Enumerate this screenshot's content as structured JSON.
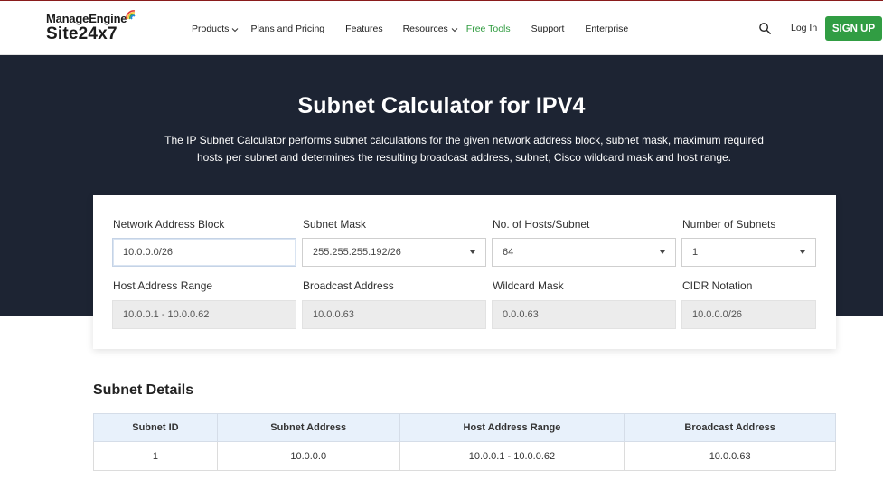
{
  "header": {
    "brand_top": "ManageEngine",
    "brand_main": "Site24x7",
    "nav": [
      {
        "label": "Products",
        "has_dropdown": true
      },
      {
        "label": "Plans and Pricing",
        "has_dropdown": false
      },
      {
        "label": "Features",
        "has_dropdown": false
      },
      {
        "label": "Resources",
        "has_dropdown": true
      },
      {
        "label": "Free Tools",
        "has_dropdown": false
      },
      {
        "label": "Support",
        "has_dropdown": false
      },
      {
        "label": "Enterprise",
        "has_dropdown": false
      }
    ],
    "login_label": "Log In",
    "signup_label": "SIGN UP",
    "search_icon": "search-icon"
  },
  "hero": {
    "title": "Subnet Calculator for IPV4",
    "description_line1": "The IP Subnet Calculator performs subnet calculations for the given network address block, subnet mask, maximum required",
    "description_line2": "hosts per subnet and determines the resulting broadcast address, subnet, Cisco wildcard mask and host range."
  },
  "calculator": {
    "network_address": {
      "label": "Network Address Block",
      "value": "10.0.0.0/26"
    },
    "subnet_mask": {
      "label": "Subnet Mask",
      "value": "255.255.255.192/26"
    },
    "hosts_per_subnet": {
      "label": "No. of Hosts/Subnet",
      "value": "64"
    },
    "number_of_subnets": {
      "label": "Number of Subnets",
      "value": "1"
    },
    "host_range": {
      "label": "Host Address Range",
      "value": "10.0.0.1 - 10.0.0.62"
    },
    "broadcast": {
      "label": "Broadcast Address",
      "value": "10.0.0.63"
    },
    "wildcard": {
      "label": "Wildcard Mask",
      "value": "0.0.0.63"
    },
    "cidr": {
      "label": "CIDR Notation",
      "value": "10.0.0.0/26"
    }
  },
  "details": {
    "title": "Subnet Details",
    "columns": [
      "Subnet ID",
      "Subnet Address",
      "Host Address Range",
      "Broadcast Address"
    ],
    "rows": [
      [
        "1",
        "10.0.0.0",
        "10.0.0.1 - 10.0.0.62",
        "10.0.0.63"
      ]
    ]
  },
  "colors": {
    "hero_bg": "#1d2433",
    "accent_green": "#319d43",
    "free_tools_green": "#2e9b3e",
    "table_header_bg": "#e8f1fb"
  }
}
